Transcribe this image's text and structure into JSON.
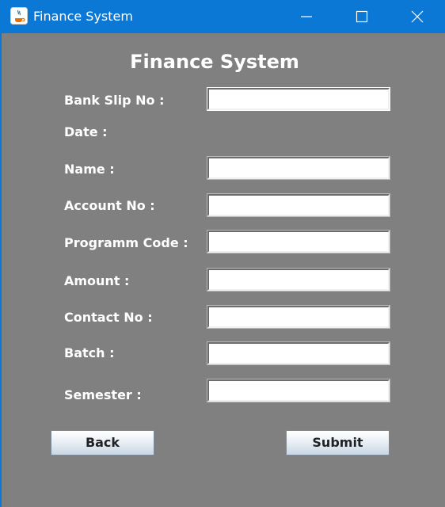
{
  "window": {
    "title": "Finance System",
    "icon": "java-icon",
    "controls": [
      "minimize-icon",
      "maximize-icon",
      "close-icon"
    ],
    "titlebar_color": "#0b78d6"
  },
  "form": {
    "heading": "Finance System",
    "background_color": "#808080",
    "labels": {
      "bank_slip": "Bank Slip No :",
      "date": "Date :",
      "name": "Name :",
      "account": "Account No :",
      "program": "Programm Code :",
      "amount": "Amount :",
      "contact": "Contact No :",
      "batch": "Batch :",
      "semester": "Semester :"
    },
    "values": {
      "bank_slip": "",
      "name": "",
      "account": "",
      "program": "",
      "amount": "",
      "contact": "",
      "batch": "",
      "semester": ""
    },
    "buttons": {
      "back": "Back",
      "submit": "Submit"
    }
  }
}
